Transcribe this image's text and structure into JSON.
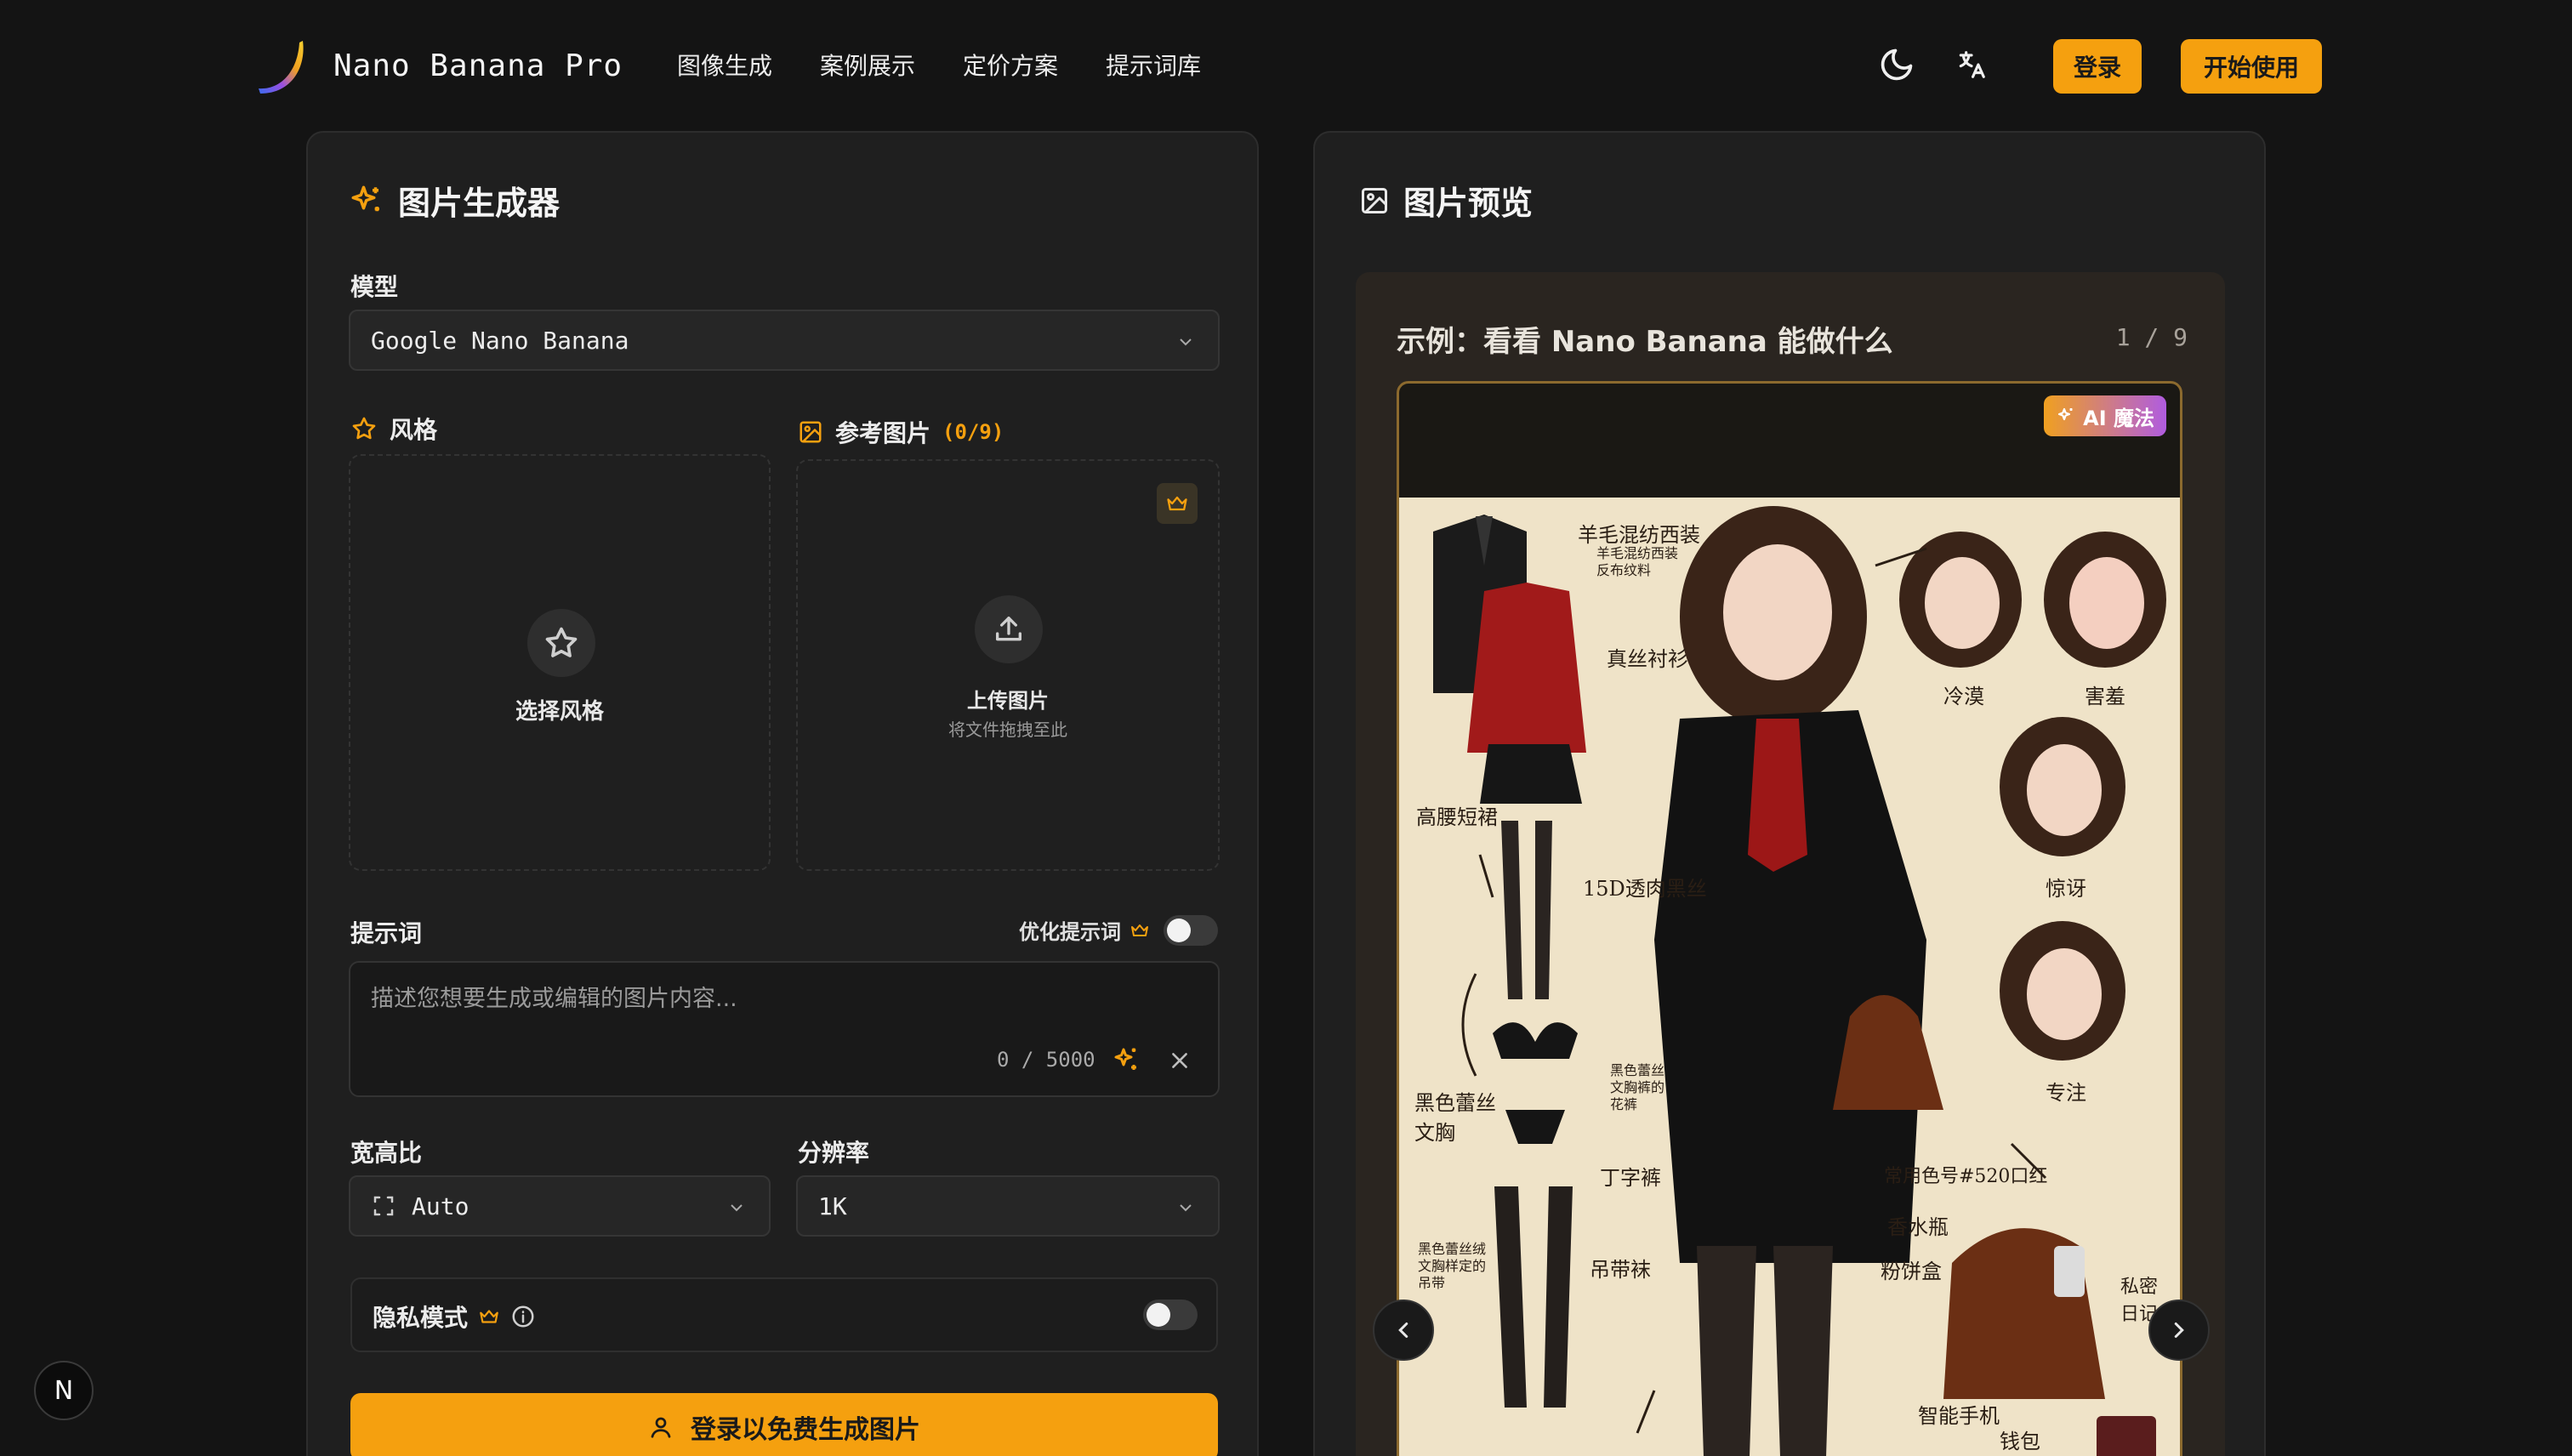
{
  "header": {
    "brand": "Nano Banana Pro",
    "nav": [
      "图像生成",
      "案例展示",
      "定价方案",
      "提示词库"
    ],
    "login_label": "登录",
    "start_label": "开始使用"
  },
  "generator": {
    "title": "图片生成器",
    "model_label": "模型",
    "model_value": "Google Nano Banana",
    "style_label": "风格",
    "style_placeholder": "选择风格",
    "ref_label": "参考图片",
    "ref_count": "(0/9)",
    "upload_label": "上传图片",
    "upload_hint": "将文件拖拽至此",
    "prompt_label": "提示词",
    "optimize_label": "优化提示词",
    "prompt_placeholder": "描述您想要生成或编辑的图片内容...",
    "char_count": "0 / 5000",
    "aspect_label": "宽高比",
    "aspect_value": "Auto",
    "resolution_label": "分辨率",
    "resolution_value": "1K",
    "privacy_label": "隐私模式",
    "generate_label": "登录以免费生成图片"
  },
  "preview": {
    "title": "图片预览",
    "example_title": "示例：看看 Nano Banana 能做什么",
    "pager": "1 / 9",
    "ai_badge": "AI 魔法",
    "annotations": {
      "blazer": "羊毛混纺西装",
      "blazer_sub1": "羊毛混纺西装",
      "blazer_sub2": "反布纹料",
      "shirt": "真丝衬衫",
      "skirt": "高腰短裙",
      "stockings": "15D透肉黑丝",
      "bra": "黑色蕾丝\n文胸",
      "panty": "黑色蕾丝\n文胸裤的\n花裤",
      "thong": "丁字裤",
      "garter": "黑色蕾丝绒\n文胸样定的\n吊带",
      "garter_belt": "吊带袜",
      "cold": "冷漠",
      "shy": "害羞",
      "surprised": "惊讶",
      "focus": "专注",
      "lipstick": "常用色号#520口红",
      "perfume": "香水瓶",
      "compact": "粉饼盒",
      "diary": "私密\n日记本",
      "phone": "智能手机",
      "wallet": "钱包"
    }
  },
  "floating_badge": "N",
  "colors": {
    "accent": "#f5a00f",
    "background": "#141414",
    "panel": "#1f1f1f"
  }
}
